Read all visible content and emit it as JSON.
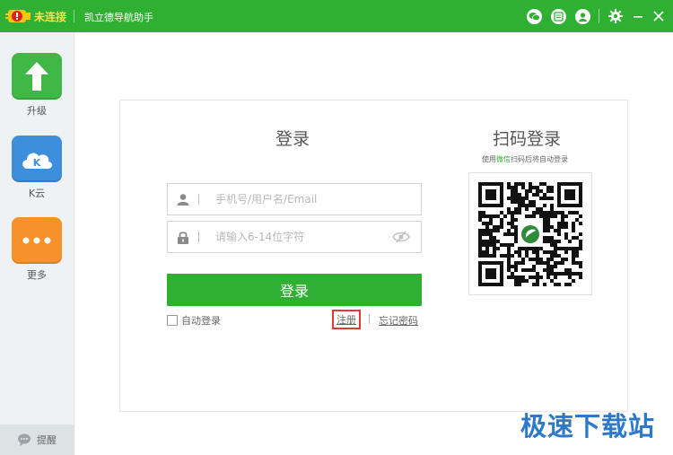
{
  "titlebar": {
    "status": "未连接",
    "app_title": "凯立德导航助手",
    "icons": [
      "wechat-icon",
      "message-icon",
      "user-icon",
      "gear-icon",
      "minimize-icon",
      "close-icon"
    ]
  },
  "sidebar": {
    "items": [
      {
        "label": "升级",
        "icon": "upgrade-arrow-icon",
        "color": "#3fb845"
      },
      {
        "label": "K云",
        "icon": "k-cloud-icon",
        "color": "#3d8fdc"
      },
      {
        "label": "更多",
        "icon": "more-dots-icon",
        "color": "#f7922b"
      }
    ],
    "reminder": "提醒"
  },
  "login": {
    "title": "登录",
    "username_placeholder": "手机号/用户名/Email",
    "password_placeholder": "请输入6-14位字符",
    "submit": "登录",
    "auto_login": "自动登录",
    "register": "注册",
    "forgot": "忘记密码"
  },
  "qr": {
    "title": "扫码登录",
    "hint_prefix": "使用",
    "hint_wechat": "微信",
    "hint_suffix": "扫码后将自动登录"
  },
  "watermark": "极速下载站",
  "colors": {
    "brand_green": "#2fb033",
    "highlight_red": "#e53935"
  }
}
